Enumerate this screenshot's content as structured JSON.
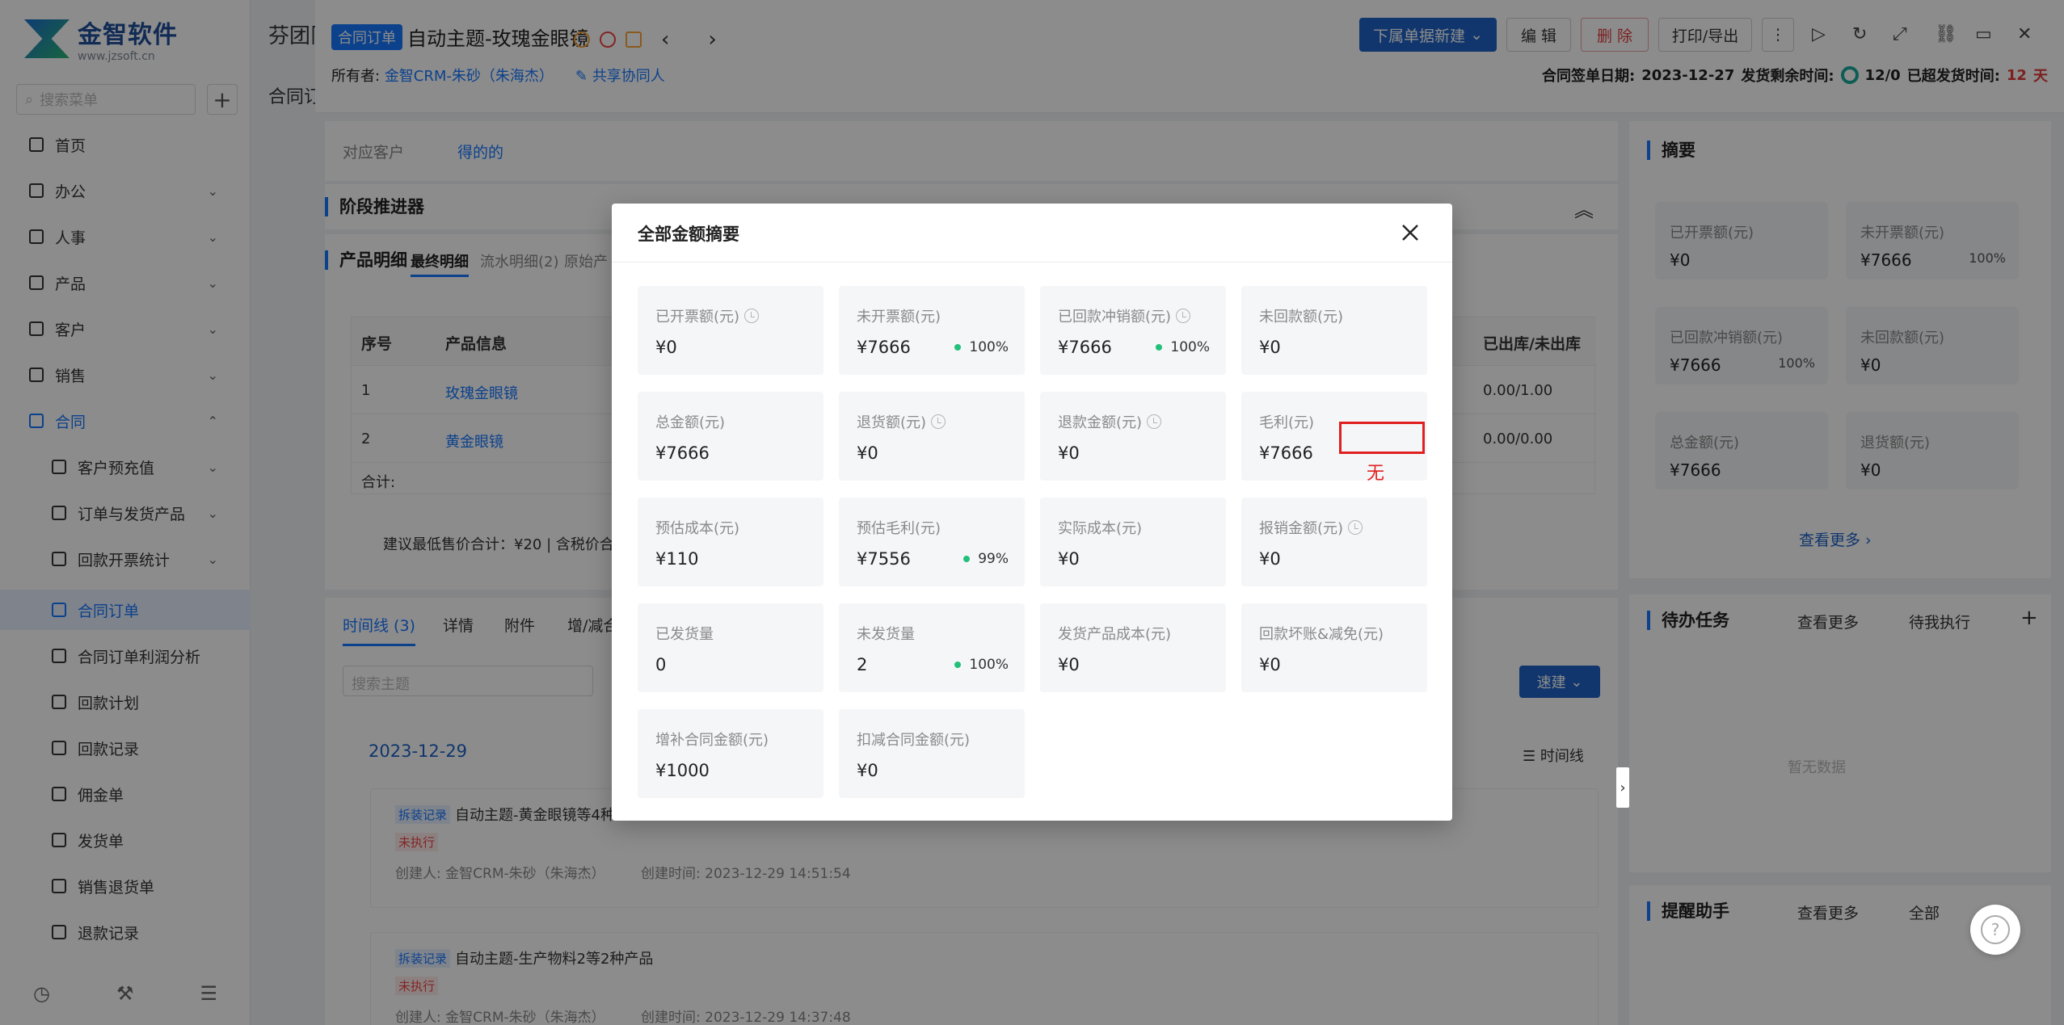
{
  "sidebar": {
    "logo_brand": "金智软件",
    "logo_url": "www.jzsoft.cn",
    "search_placeholder": "搜索菜单",
    "items": [
      {
        "label": "首页"
      },
      {
        "label": "办公"
      },
      {
        "label": "人事"
      },
      {
        "label": "产品"
      },
      {
        "label": "客户"
      },
      {
        "label": "销售"
      },
      {
        "label": "合同"
      },
      {
        "label": "客户预充值"
      },
      {
        "label": "订单与发货产品"
      },
      {
        "label": "回款开票统计"
      },
      {
        "label": "合同订单"
      },
      {
        "label": "合同订单利润分析"
      },
      {
        "label": "回款计划"
      },
      {
        "label": "回款记录"
      },
      {
        "label": "佣金单"
      },
      {
        "label": "发货单"
      },
      {
        "label": "销售退货单"
      },
      {
        "label": "退款记录"
      }
    ]
  },
  "background": {
    "page_title": "芬团队",
    "tab_label": "合同订"
  },
  "header": {
    "tag": "合同订单",
    "title": "自动主题-玫瑰金眼镜",
    "owner_label": "所有者:",
    "owner_value": "金智CRM-朱砂（朱海杰）",
    "share_label": "共享协同人",
    "sign_label": "合同签单日期:",
    "sign_date": "2023-12-27",
    "ship_remaining_label": "发货剩余时间:",
    "ship_remaining_value": "12/0",
    "overdue_label": "已超发货时间:",
    "overdue_value": "12",
    "overdue_unit": "天",
    "btn_new_down": "下属单据新建",
    "btn_edit": "编 辑",
    "btn_delete": "删 除",
    "btn_print": "打印/导出"
  },
  "customer": {
    "label": "对应客户",
    "value": "得的的"
  },
  "stage": {
    "title": "阶段推进器"
  },
  "product": {
    "title": "产品明细",
    "tabs": [
      "最终明细",
      "流水明细(2)",
      "原始产"
    ],
    "columns": [
      "序号",
      "产品信息",
      "已出库/未出库"
    ],
    "rows": [
      {
        "no": "1",
        "name": "玫瑰金眼镜",
        "stock": "0.00/1.00"
      },
      {
        "no": "2",
        "name": "黄金眼镜",
        "stock": "0.00/0.00"
      }
    ],
    "total_label": "合计:",
    "footer_text": "建议最低售价合计：¥20 |   含税价合"
  },
  "timeline": {
    "tabs": [
      "时间线 (3)",
      "详情",
      "附件",
      "增/减合"
    ],
    "search_placeholder": "搜索主题",
    "quick_btn": "速建",
    "date": "2023-12-29",
    "view_label": "时间线",
    "entries": [
      {
        "tag": "拆装记录",
        "title": "自动主题-黄金眼镜等4种",
        "status": "未执行",
        "creator": "创建人: 金智CRM-朱砂（朱海杰）",
        "time": "创建时间: 2023-12-29 14:51:54"
      },
      {
        "tag": "拆装记录",
        "title": "自动主题-生产物料2等2种产品",
        "status": "未执行",
        "creator": "创建人: 金智CRM-朱砂（朱海杰）",
        "time": "创建时间: 2023-12-29 14:37:48"
      }
    ]
  },
  "summary": {
    "title": "摘要",
    "tiles": [
      {
        "label": "已开票额(元)",
        "value": "¥0",
        "pct": ""
      },
      {
        "label": "未开票额(元)",
        "value": "¥7666",
        "pct": "100%"
      },
      {
        "label": "已回款冲销额(元)",
        "value": "¥7666",
        "pct": "100%"
      },
      {
        "label": "未回款额(元)",
        "value": "¥0",
        "pct": ""
      },
      {
        "label": "总金额(元)",
        "value": "¥7666",
        "pct": ""
      },
      {
        "label": "退货额(元)",
        "value": "¥0",
        "pct": ""
      }
    ],
    "more": "查看更多"
  },
  "todo": {
    "title": "待办任务",
    "more": "查看更多",
    "filter": "待我执行",
    "empty": "暂无数据"
  },
  "remind": {
    "title": "提醒助手",
    "more": "查看更多",
    "filter": "全部"
  },
  "modal": {
    "title": "全部金额摘要",
    "tiles": [
      {
        "label": "已开票额(元)",
        "value": "¥0",
        "pct": "",
        "clock": true
      },
      {
        "label": "未开票额(元)",
        "value": "¥7666",
        "pct": "100%",
        "clock": false
      },
      {
        "label": "已回款冲销额(元)",
        "value": "¥7666",
        "pct": "100%",
        "clock": true
      },
      {
        "label": "未回款额(元)",
        "value": "¥0",
        "pct": "",
        "clock": false
      },
      {
        "label": "总金额(元)",
        "value": "¥7666",
        "pct": "",
        "clock": false
      },
      {
        "label": "退货额(元)",
        "value": "¥0",
        "pct": "",
        "clock": true
      },
      {
        "label": "退款金额(元)",
        "value": "¥0",
        "pct": "",
        "clock": true
      },
      {
        "label": "毛利(元)",
        "value": "¥7666",
        "pct": "",
        "clock": false
      },
      {
        "label": "预估成本(元)",
        "value": "¥110",
        "pct": "",
        "clock": false
      },
      {
        "label": "预估毛利(元)",
        "value": "¥7556",
        "pct": "99%",
        "clock": false
      },
      {
        "label": "实际成本(元)",
        "value": "¥0",
        "pct": "",
        "clock": false
      },
      {
        "label": "报销金额(元)",
        "value": "¥0",
        "pct": "",
        "clock": true
      },
      {
        "label": "已发货量",
        "value": "0",
        "pct": "",
        "clock": false
      },
      {
        "label": "未发货量",
        "value": "2",
        "pct": "100%",
        "clock": false
      },
      {
        "label": "发货产品成本(元)",
        "value": "¥0",
        "pct": "",
        "clock": false
      },
      {
        "label": "回款坏账&减免(元)",
        "value": "¥0",
        "pct": "",
        "clock": false
      },
      {
        "label": "增补合同金额(元)",
        "value": "¥1000",
        "pct": "",
        "clock": false
      },
      {
        "label": "扣减合同金额(元)",
        "value": "¥0",
        "pct": "",
        "clock": false
      }
    ],
    "annotation": "无"
  },
  "colors": {
    "accent": "#1677ff",
    "overlay": "rgba(0,0,0,0.45)",
    "success_dot": "#22c07a",
    "annotation_red": "#e02020"
  }
}
